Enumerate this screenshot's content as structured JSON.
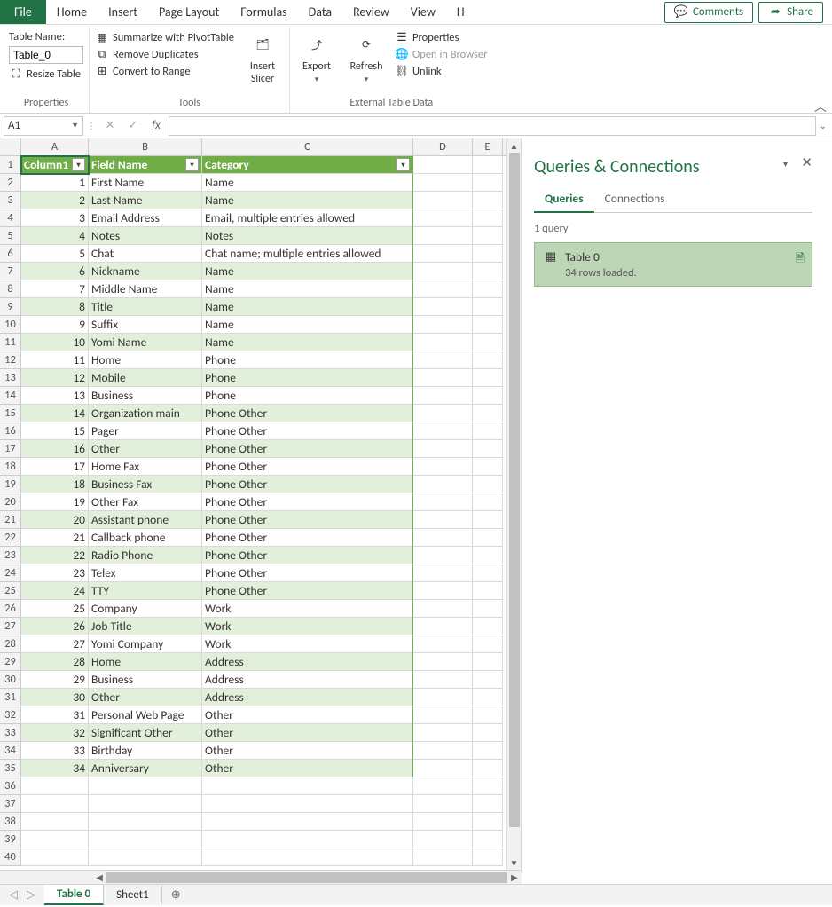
{
  "ribbon": {
    "file": "File",
    "tabs": [
      "Home",
      "Insert",
      "Page Layout",
      "Formulas",
      "Data",
      "Review",
      "View",
      "H"
    ],
    "comments": "Comments",
    "share": "Share"
  },
  "ribbon_groups": {
    "properties": {
      "table_name_label": "Table Name:",
      "table_name_value": "Table_0",
      "resize": "Resize Table",
      "group_label": "Properties"
    },
    "tools": {
      "summarize": "Summarize with PivotTable",
      "dup": "Remove Duplicates",
      "range": "Convert to Range",
      "group_label": "Tools"
    },
    "slicer": {
      "label": "Insert\nSlicer"
    },
    "export": {
      "label": "Export"
    },
    "refresh": {
      "label": "Refresh"
    },
    "ext": {
      "props": "Properties",
      "browser": "Open in Browser",
      "unlink": "Unlink",
      "group_label": "External Table Data"
    }
  },
  "formula_bar": {
    "name_box": "A1"
  },
  "columns": [
    "A",
    "B",
    "C",
    "D",
    "E"
  ],
  "table_headers": [
    "Column1",
    "Field Name",
    "Category"
  ],
  "table_rows": [
    {
      "n": 1,
      "f": "First Name",
      "c": "Name"
    },
    {
      "n": 2,
      "f": "Last Name",
      "c": "Name"
    },
    {
      "n": 3,
      "f": "Email Address",
      "c": "Email, multiple entries allowed"
    },
    {
      "n": 4,
      "f": "Notes",
      "c": "Notes"
    },
    {
      "n": 5,
      "f": "Chat",
      "c": "Chat name;  multiple entries allowed"
    },
    {
      "n": 6,
      "f": "Nickname",
      "c": "Name"
    },
    {
      "n": 7,
      "f": "Middle Name",
      "c": "Name"
    },
    {
      "n": 8,
      "f": "Title",
      "c": "Name"
    },
    {
      "n": 9,
      "f": "Suffix",
      "c": "Name"
    },
    {
      "n": 10,
      "f": "Yomi Name",
      "c": "Name"
    },
    {
      "n": 11,
      "f": "Home",
      "c": "Phone"
    },
    {
      "n": 12,
      "f": "Mobile",
      "c": "Phone"
    },
    {
      "n": 13,
      "f": "Business",
      "c": "Phone"
    },
    {
      "n": 14,
      "f": "Organization main",
      "c": "Phone Other"
    },
    {
      "n": 15,
      "f": "Pager",
      "c": "Phone Other"
    },
    {
      "n": 16,
      "f": "Other",
      "c": "Phone Other"
    },
    {
      "n": 17,
      "f": "Home Fax",
      "c": "Phone Other"
    },
    {
      "n": 18,
      "f": "Business Fax",
      "c": "Phone Other"
    },
    {
      "n": 19,
      "f": "Other Fax",
      "c": "Phone Other"
    },
    {
      "n": 20,
      "f": "Assistant phone",
      "c": "Phone Other"
    },
    {
      "n": 21,
      "f": "Callback phone",
      "c": "Phone Other"
    },
    {
      "n": 22,
      "f": "Radio Phone",
      "c": "Phone Other"
    },
    {
      "n": 23,
      "f": "Telex",
      "c": "Phone Other"
    },
    {
      "n": 24,
      "f": "TTY",
      "c": "Phone Other"
    },
    {
      "n": 25,
      "f": "Company",
      "c": "Work"
    },
    {
      "n": 26,
      "f": "Job Title",
      "c": "Work"
    },
    {
      "n": 27,
      "f": "Yomi Company",
      "c": "Work"
    },
    {
      "n": 28,
      "f": "Home",
      "c": "Address"
    },
    {
      "n": 29,
      "f": "Business",
      "c": "Address"
    },
    {
      "n": 30,
      "f": "Other",
      "c": "Address"
    },
    {
      "n": 31,
      "f": "Personal Web Page",
      "c": "Other"
    },
    {
      "n": 32,
      "f": "Significant Other",
      "c": "Other"
    },
    {
      "n": 33,
      "f": "Birthday",
      "c": "Other"
    },
    {
      "n": 34,
      "f": "Anniversary",
      "c": "Other"
    }
  ],
  "empty_rows_after": 5,
  "queries_panel": {
    "title": "Queries & Connections",
    "tab_queries": "Queries",
    "tab_connections": "Connections",
    "count_text": "1 query",
    "card_name": "Table 0",
    "card_status": "34 rows loaded."
  },
  "sheet_tabs": {
    "active": "Table 0",
    "other": "Sheet1"
  }
}
